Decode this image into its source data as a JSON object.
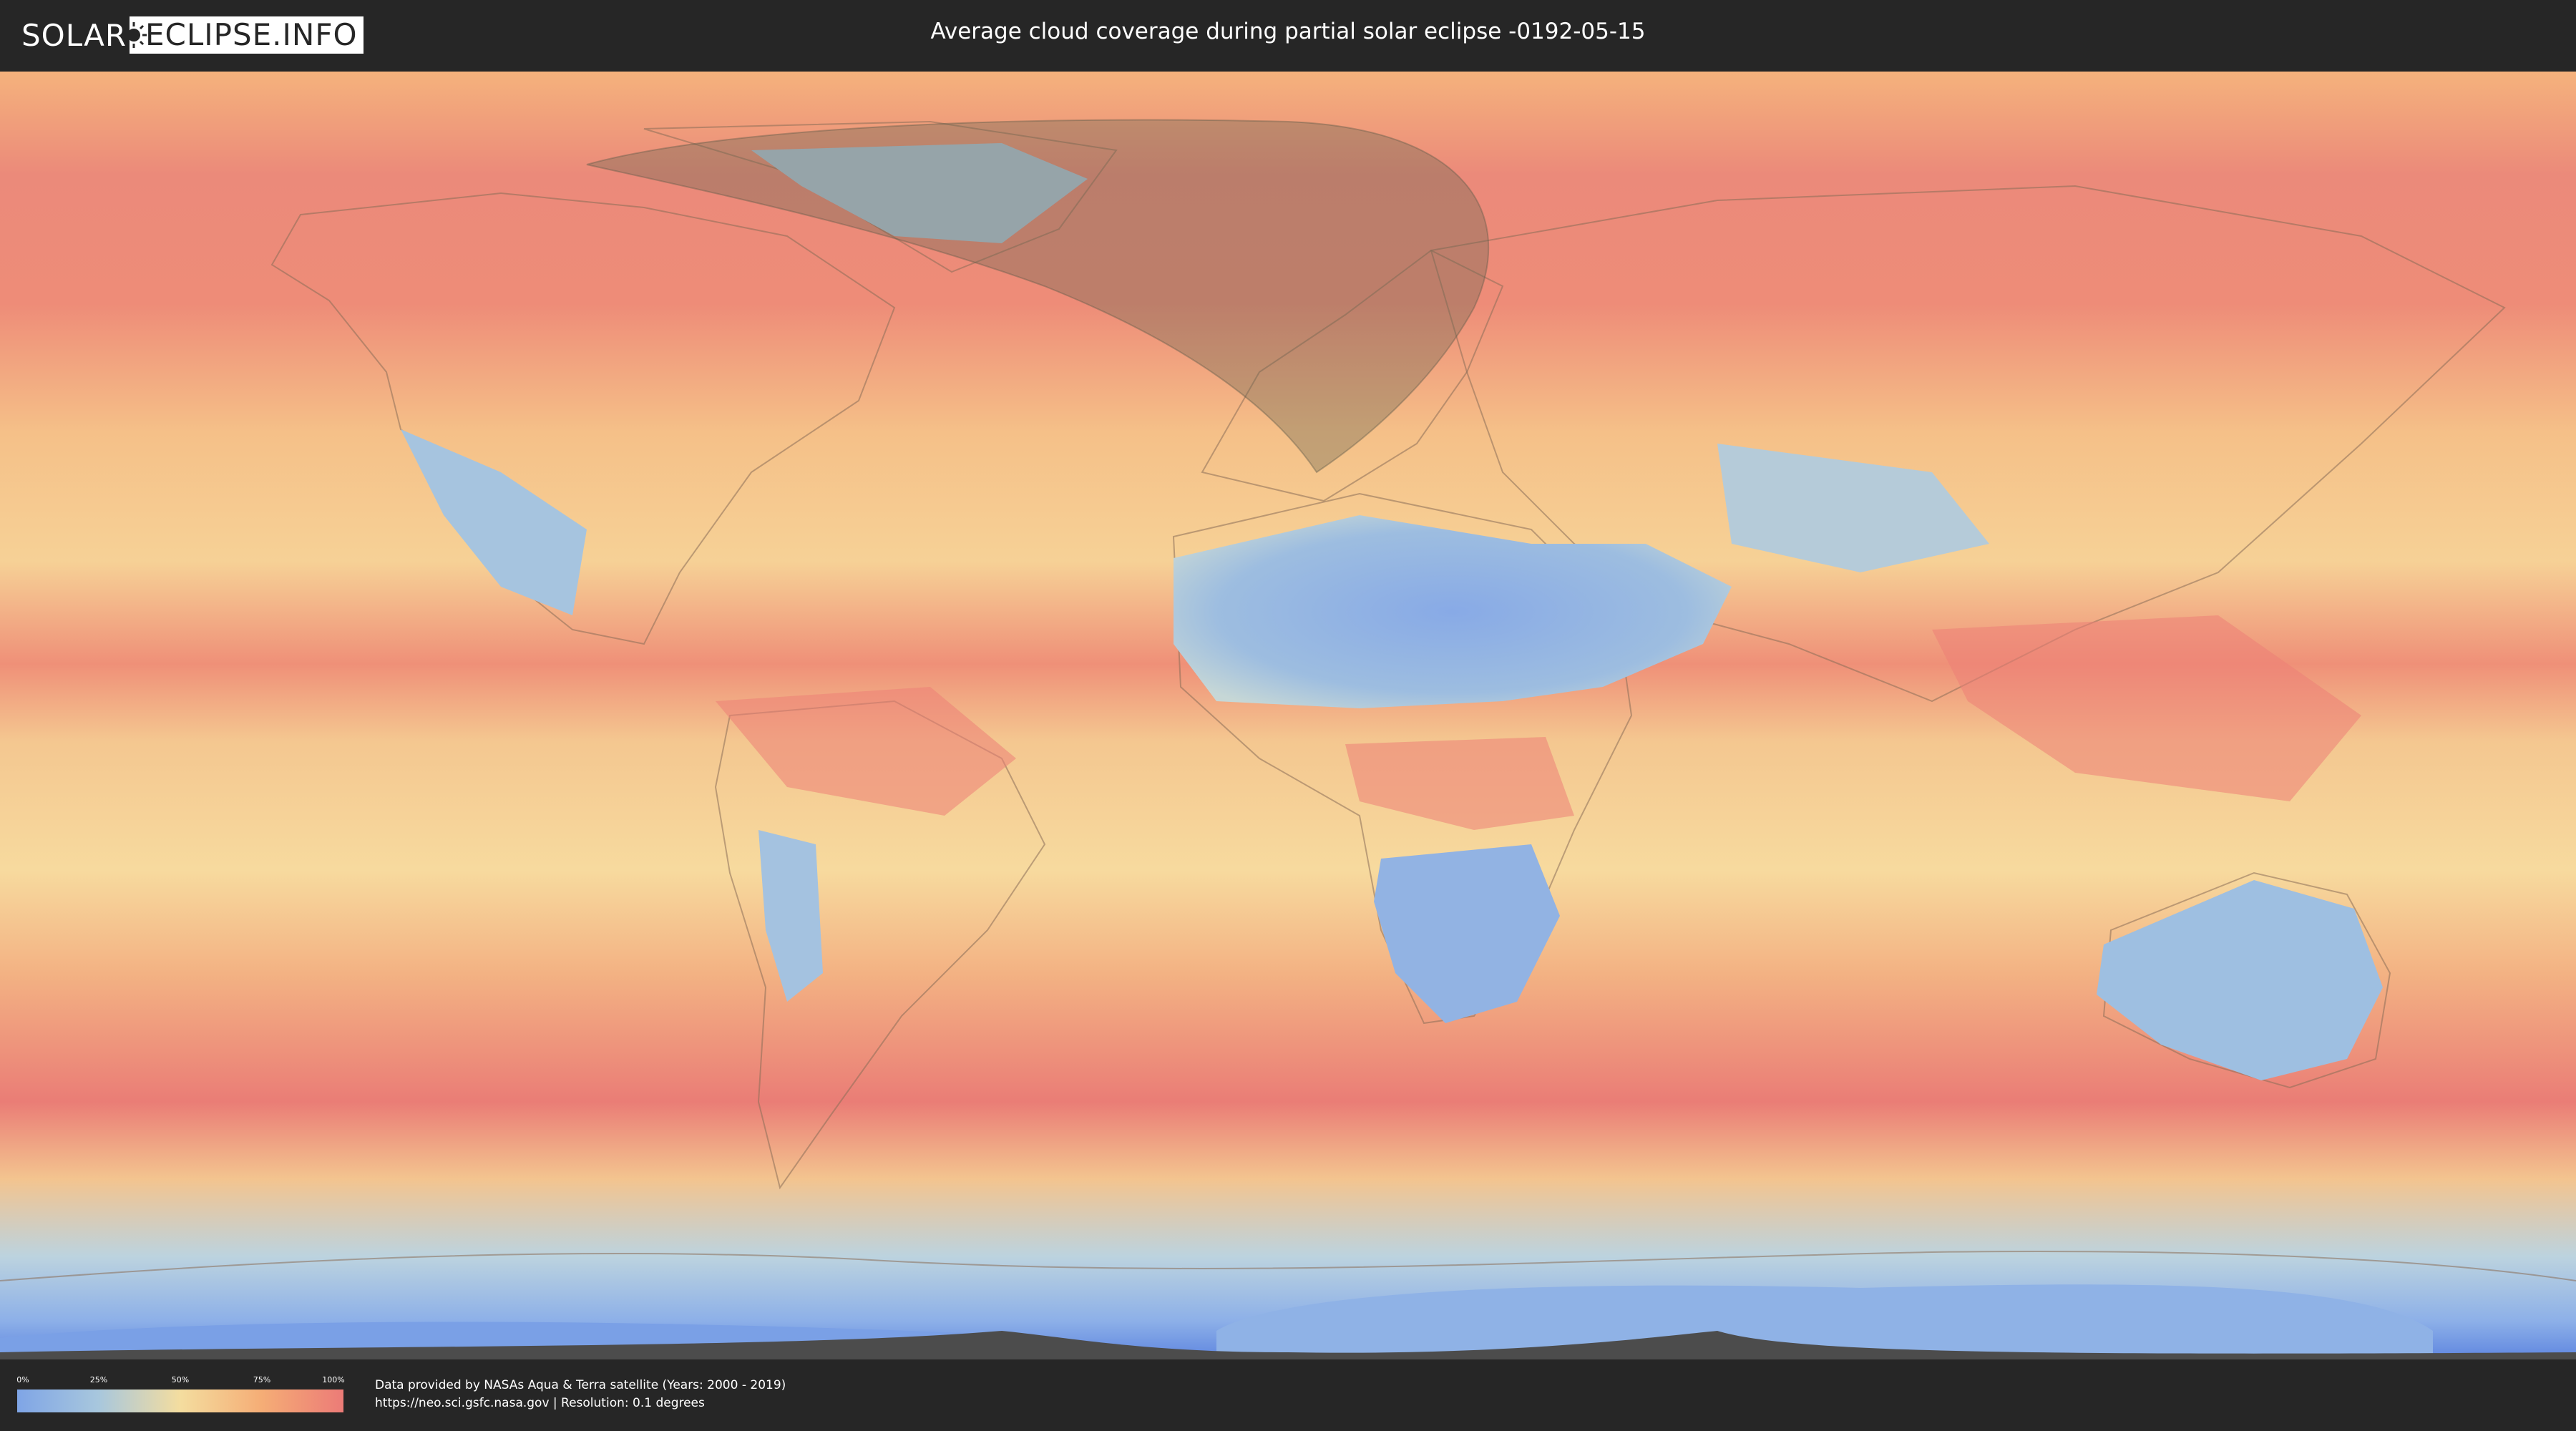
{
  "header": {
    "logo_part1": "SOLAR",
    "logo_part2": "ECLIPSE.INFO",
    "title": "Average cloud coverage during partial solar eclipse -0192-05-15"
  },
  "legend": {
    "ticks": [
      "0%",
      "25%",
      "50%",
      "75%",
      "100%"
    ],
    "colors": [
      "#7fa5e6",
      "#a8c7dd",
      "#f4dd9f",
      "#f5ad76",
      "#ec7b77"
    ]
  },
  "credits": {
    "line1": "Data provided by NASAs Aqua & Terra satellite (Years: 2000 - 2019)",
    "line2": "https://neo.sci.gsfc.nasa.gov | Resolution: 0.1 degrees"
  },
  "map": {
    "icons": [
      "sun-eclipse-icon"
    ],
    "eclipse_region": "partial eclipse visibility area over Greenland, North Atlantic and Scandinavia",
    "colors": {
      "cloudy_high": "#ec7b77",
      "cloudy_mid": "#f5ad76",
      "mixed": "#f4dd9f",
      "clear": "#a8c7dd",
      "very_clear": "#7fa5e6",
      "shadow": "#6e6a55"
    }
  }
}
